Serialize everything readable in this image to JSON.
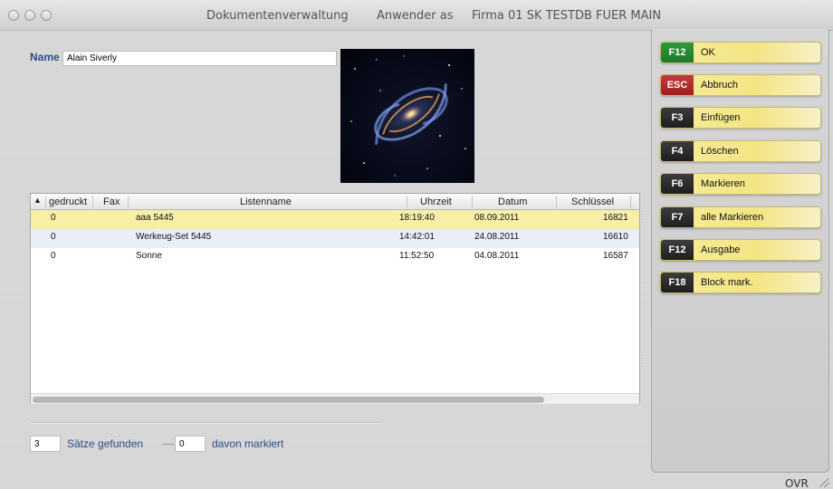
{
  "titlebar": {
    "app_title": "Dokumentenverwaltung",
    "user": "Anwender as",
    "firm": "Firma 01 SK TESTDB FUER MAIN"
  },
  "name_field": {
    "label": "Name",
    "value": "Alain Siverly"
  },
  "table": {
    "sort_indicator": "▲",
    "columns": [
      "gedruckt",
      "Fax",
      "Listenname",
      "Uhrzeit",
      "Datum",
      "Schlüssel"
    ],
    "rows": [
      {
        "gedruckt": "0",
        "fax": "",
        "listenname": "aaa 5445",
        "uhrzeit": "18:19:40",
        "datum": "08.09.2011",
        "schluessel": "16821",
        "selected": true
      },
      {
        "gedruckt": "0",
        "fax": "",
        "listenname": "Werkeug-Set 5445",
        "uhrzeit": "14:42:01",
        "datum": "24.08.2011",
        "schluessel": "16610",
        "selected": false
      },
      {
        "gedruckt": "0",
        "fax": "",
        "listenname": "Sonne",
        "uhrzeit": "11:52:50",
        "datum": "04.08.2011",
        "schluessel": "16587",
        "selected": false
      }
    ],
    "scroll_position": 0.0
  },
  "footer": {
    "found_count": "3",
    "found_label": "Sätze gefunden",
    "marked_count": "0",
    "marked_label": "davon markiert"
  },
  "actions": [
    {
      "key": "F12",
      "label": "OK",
      "key_color": "green"
    },
    {
      "key": "ESC",
      "label": "Abbruch",
      "key_color": "red"
    },
    {
      "key": "F3",
      "label": "Einfügen",
      "key_color": "dark"
    },
    {
      "key": "F4",
      "label": "Löschen",
      "key_color": "dark"
    },
    {
      "key": "F6",
      "label": "Markieren",
      "key_color": "dark"
    },
    {
      "key": "F7",
      "label": "alle Markieren",
      "key_color": "dark"
    },
    {
      "key": "F12",
      "label": "Ausgabe",
      "key_color": "dark"
    },
    {
      "key": "F18",
      "label": "Block mark.",
      "key_color": "dark"
    }
  ],
  "status": {
    "mode": "OVR"
  },
  "colors": {
    "accent_blue": "#2a4e8c",
    "selected_row": "#f7efa6",
    "alt_row": "#e9eef7",
    "button_yellow": "#f3e584"
  },
  "icons": {
    "sort": "sort-ascending-icon",
    "resize": "resize-grip-icon"
  }
}
